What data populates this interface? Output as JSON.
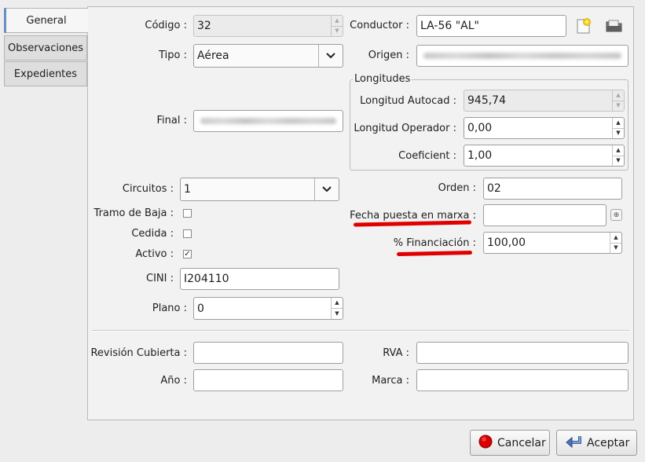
{
  "tabs": [
    {
      "label": "General",
      "active": true
    },
    {
      "label": "Observaciones",
      "active": false
    },
    {
      "label": "Expedientes",
      "active": false
    }
  ],
  "left": {
    "codigo": {
      "label": "Código :",
      "value": "32"
    },
    "tipo": {
      "label": "Tipo :",
      "value": "Aérea"
    },
    "final": {
      "label": "Final :"
    },
    "circuitos": {
      "label": "Circuitos :",
      "value": "1"
    },
    "tramo_de_baja": {
      "label": "Tramo de Baja :",
      "checked": false
    },
    "cedida": {
      "label": "Cedida :",
      "checked": false
    },
    "activo": {
      "label": "Activo :",
      "checked": true
    },
    "cini": {
      "label": "CINI :",
      "value": "I204110"
    },
    "plano": {
      "label": "Plano :",
      "value": "0"
    }
  },
  "right": {
    "conductor": {
      "label": "Conductor :",
      "value": "LA-56 \"AL\""
    },
    "origen": {
      "label": "Origen :"
    },
    "longitudes": {
      "title": "Longitudes",
      "autocad": {
        "label": "Longitud Autocad :",
        "value": "945,74"
      },
      "operador": {
        "label": "Longitud Operador :",
        "value": "0,00"
      },
      "coeficient": {
        "label": "Coeficient :",
        "value": "1,00"
      }
    },
    "orden": {
      "label": "Orden :",
      "value": "02"
    },
    "fecha": {
      "label": "Fecha puesta en marxa :",
      "value": ""
    },
    "financiacion": {
      "label": "% Financiación :",
      "value": "100,00"
    }
  },
  "bottom": {
    "revision": {
      "label": "Revisión Cubierta :",
      "value": ""
    },
    "ano": {
      "label": "Año :",
      "value": ""
    },
    "rva": {
      "label": "RVA :",
      "value": ""
    },
    "marca": {
      "label": "Marca :",
      "value": ""
    }
  },
  "buttons": {
    "cancel": "Cancelar",
    "accept": "Aceptar"
  },
  "colors": {
    "annotation_red": "#e00000",
    "cancel_icon": "#d80000",
    "accept_icon": "#4a74b8"
  }
}
